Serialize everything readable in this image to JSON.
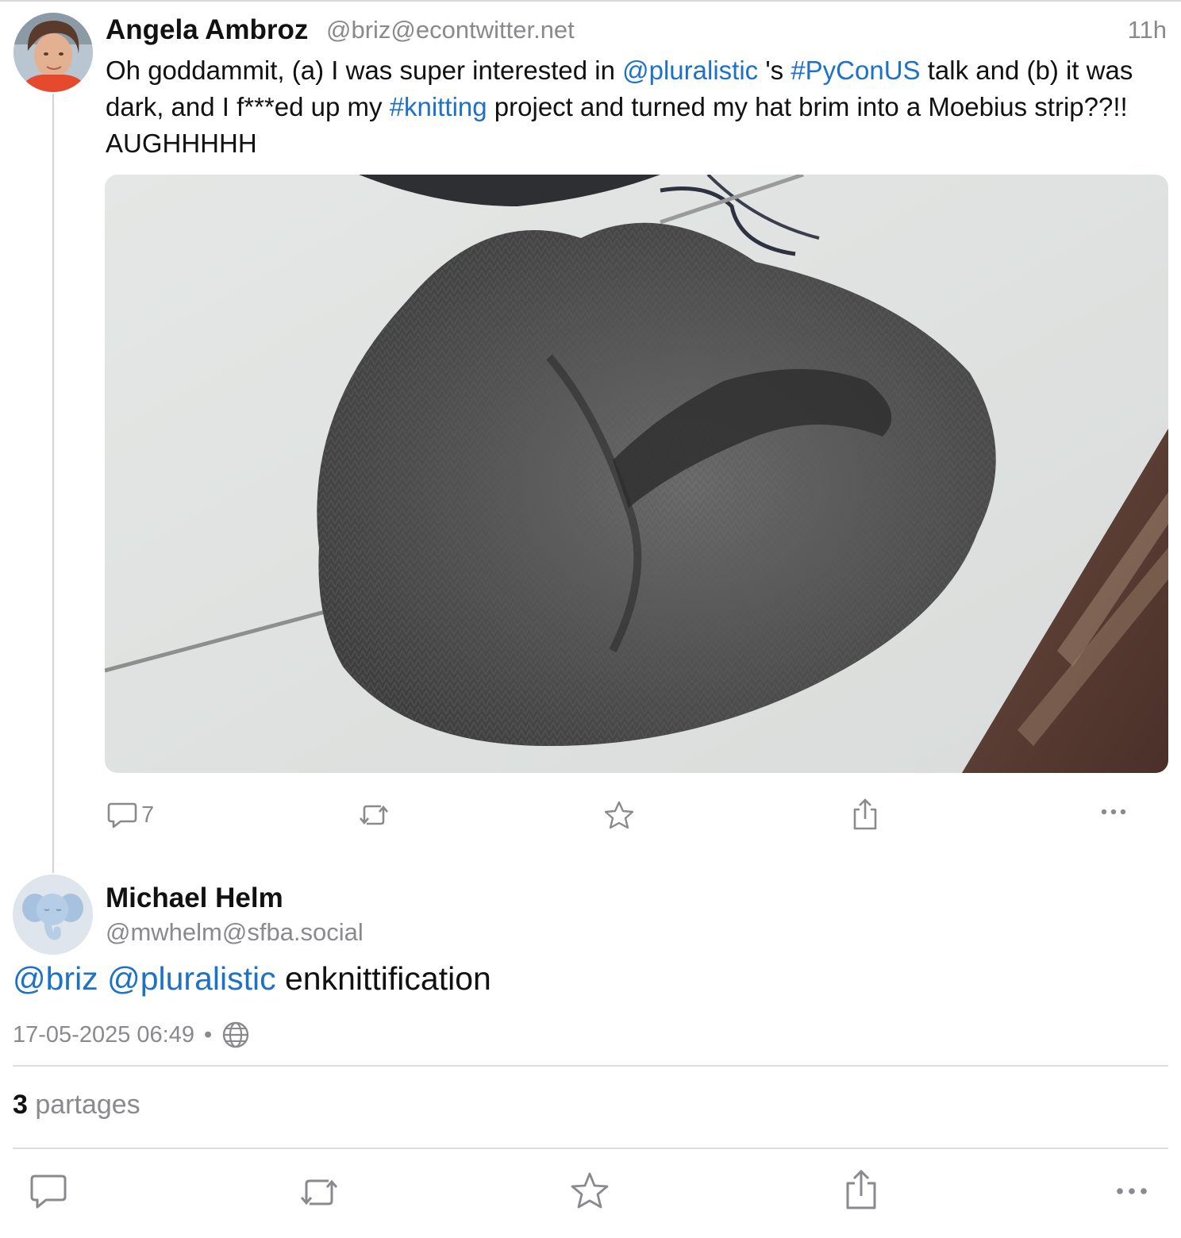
{
  "post": {
    "author_name": "Angela Ambroz",
    "author_handle": "@briz@econtwitter.net",
    "time_ago": "11h",
    "text_1": "Oh goddammit, (a) I was super interested in ",
    "mention_1": "@pluralistic",
    "text_2": " 's ",
    "hashtag_1": "#PyConUS",
    "text_3": " talk and (b) it was dark, and I f***ed up my ",
    "hashtag_2": "#knitting",
    "text_4": " project and turned my hat brim into a Moebius strip??!! AUGHHHHH",
    "reply_count": "7",
    "icons": {
      "reply": "reply-icon",
      "boost": "boost-icon",
      "favourite": "star-icon",
      "share": "share-icon",
      "more": "more-icon"
    }
  },
  "reply": {
    "author_name": "Michael Helm",
    "author_handle": "@mwhelm@sfba.social",
    "mention_1": "@briz",
    "mention_2": "@pluralistic",
    "text": " enknittification",
    "timestamp": "17-05-2025 06:49",
    "separator": "•",
    "visibility_icon": "globe-icon"
  },
  "stats": {
    "shares_count": "3",
    "shares_label": " partages"
  },
  "colors": {
    "link": "#1d72c8",
    "muted": "#8a8a8e",
    "divider": "#dcdcdc"
  }
}
